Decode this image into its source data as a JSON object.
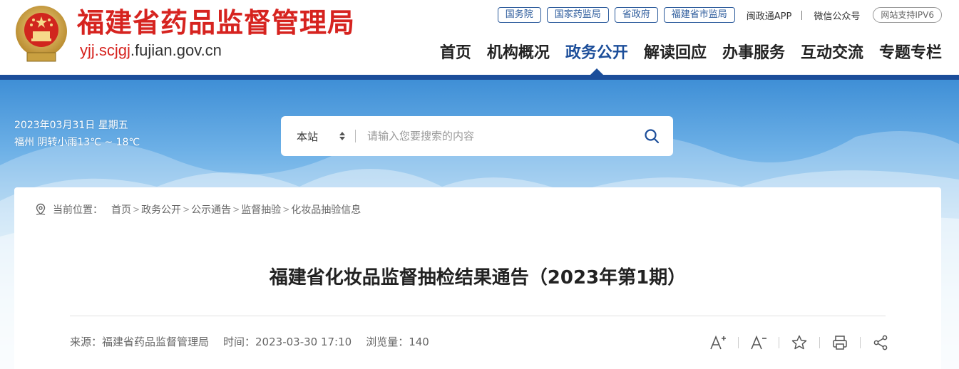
{
  "header": {
    "site_title": "福建省药品监督管理局",
    "domain_red": "yjj.scjgj",
    "domain_rest": ".fujian.gov.cn",
    "top_links": [
      "国务院",
      "国家药监局",
      "省政府",
      "福建省市监局"
    ],
    "app_link": "闽政通APP",
    "wechat_link": "微信公众号",
    "ipv6_badge": "网站支持IPV6"
  },
  "nav": {
    "items": [
      {
        "label": "首页",
        "active": false
      },
      {
        "label": "机构概况",
        "active": false
      },
      {
        "label": "政务公开",
        "active": true
      },
      {
        "label": "解读回应",
        "active": false
      },
      {
        "label": "办事服务",
        "active": false
      },
      {
        "label": "互动交流",
        "active": false
      },
      {
        "label": "专题专栏",
        "active": false
      }
    ]
  },
  "weather": {
    "date_line": "2023年03月31日 星期五",
    "weather_line": "福州 阴转小雨13℃ ~ 18℃"
  },
  "search": {
    "scope": "本站",
    "placeholder": "请输入您要搜索的内容"
  },
  "breadcrumb": {
    "label": "当前位置：",
    "items": [
      "首页",
      "政务公开",
      "公示通告",
      "监督抽验",
      "化妆品抽验信息"
    ],
    "separator": ">"
  },
  "article": {
    "title": "福建省化妆品监督抽检结果通告（2023年第1期）",
    "source": "来源：福建省药品监督管理局",
    "time": "时间：2023-03-30 17:10",
    "views": "浏览量：140"
  },
  "tools": [
    "font-increase-icon",
    "font-decrease-icon",
    "star-icon",
    "print-icon",
    "share-icon"
  ],
  "colors": {
    "brand_red": "#d6231f",
    "brand_blue": "#1c4e9a"
  }
}
